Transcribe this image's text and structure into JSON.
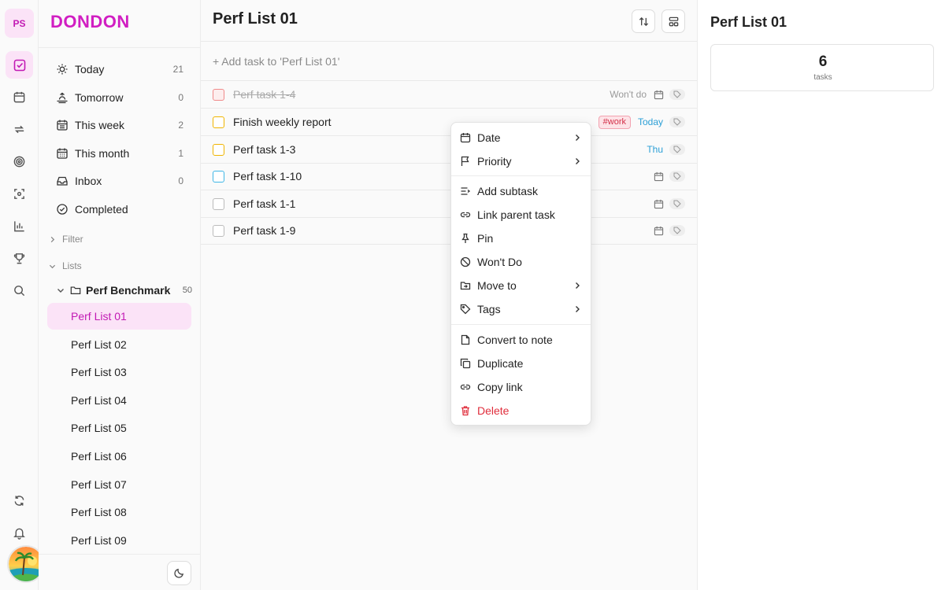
{
  "rail": {
    "avatar_initials": "PS"
  },
  "brand": {
    "name": "DONDON"
  },
  "nav": [
    {
      "label": "Today",
      "count": "21"
    },
    {
      "label": "Tomorrow",
      "count": "0"
    },
    {
      "label": "This week",
      "count": "2"
    },
    {
      "label": "This month",
      "count": "1"
    },
    {
      "label": "Inbox",
      "count": "0"
    },
    {
      "label": "Completed",
      "count": ""
    }
  ],
  "sections": {
    "filter": "Filter",
    "lists": "Lists"
  },
  "folder": {
    "name": "Perf Benchmark",
    "count": "50"
  },
  "lists": [
    "Perf List 01",
    "Perf List 02",
    "Perf List 03",
    "Perf List 04",
    "Perf List 05",
    "Perf List 06",
    "Perf List 07",
    "Perf List 08",
    "Perf List 09"
  ],
  "main": {
    "title": "Perf List 01",
    "add_task_placeholder": "+ Add task to 'Perf List 01'",
    "tasks": [
      {
        "title": "Perf task 1-4",
        "status": "Won't do",
        "priority_color": "#f08a8a",
        "completed": true
      },
      {
        "title": "Finish weekly report",
        "tags": [
          "#work"
        ],
        "due": "Today",
        "priority_color": "#f0b400"
      },
      {
        "title": "Perf task 1-3",
        "due": "Thu",
        "priority_color": "#f0b400"
      },
      {
        "title": "Perf task 1-10",
        "priority_color": "#3fb6e6"
      },
      {
        "title": "Perf task 1-1",
        "priority_color": "#bbbbbb"
      },
      {
        "title": "Perf task 1-9",
        "priority_color": "#bbbbbb"
      }
    ]
  },
  "context_menu": {
    "items": [
      "Date",
      "Priority",
      "Add subtask",
      "Link parent task",
      "Pin",
      "Won't Do",
      "Move to",
      "Tags",
      "Convert to note",
      "Duplicate",
      "Copy link",
      "Delete"
    ]
  },
  "detail": {
    "title": "Perf List 01",
    "task_count": "6",
    "task_count_label": "tasks"
  },
  "colors": {
    "brand": "#d11ec2",
    "accent_bg": "#fbe3f7",
    "due_blue": "#2b9fd6",
    "danger": "#e02e3c"
  }
}
